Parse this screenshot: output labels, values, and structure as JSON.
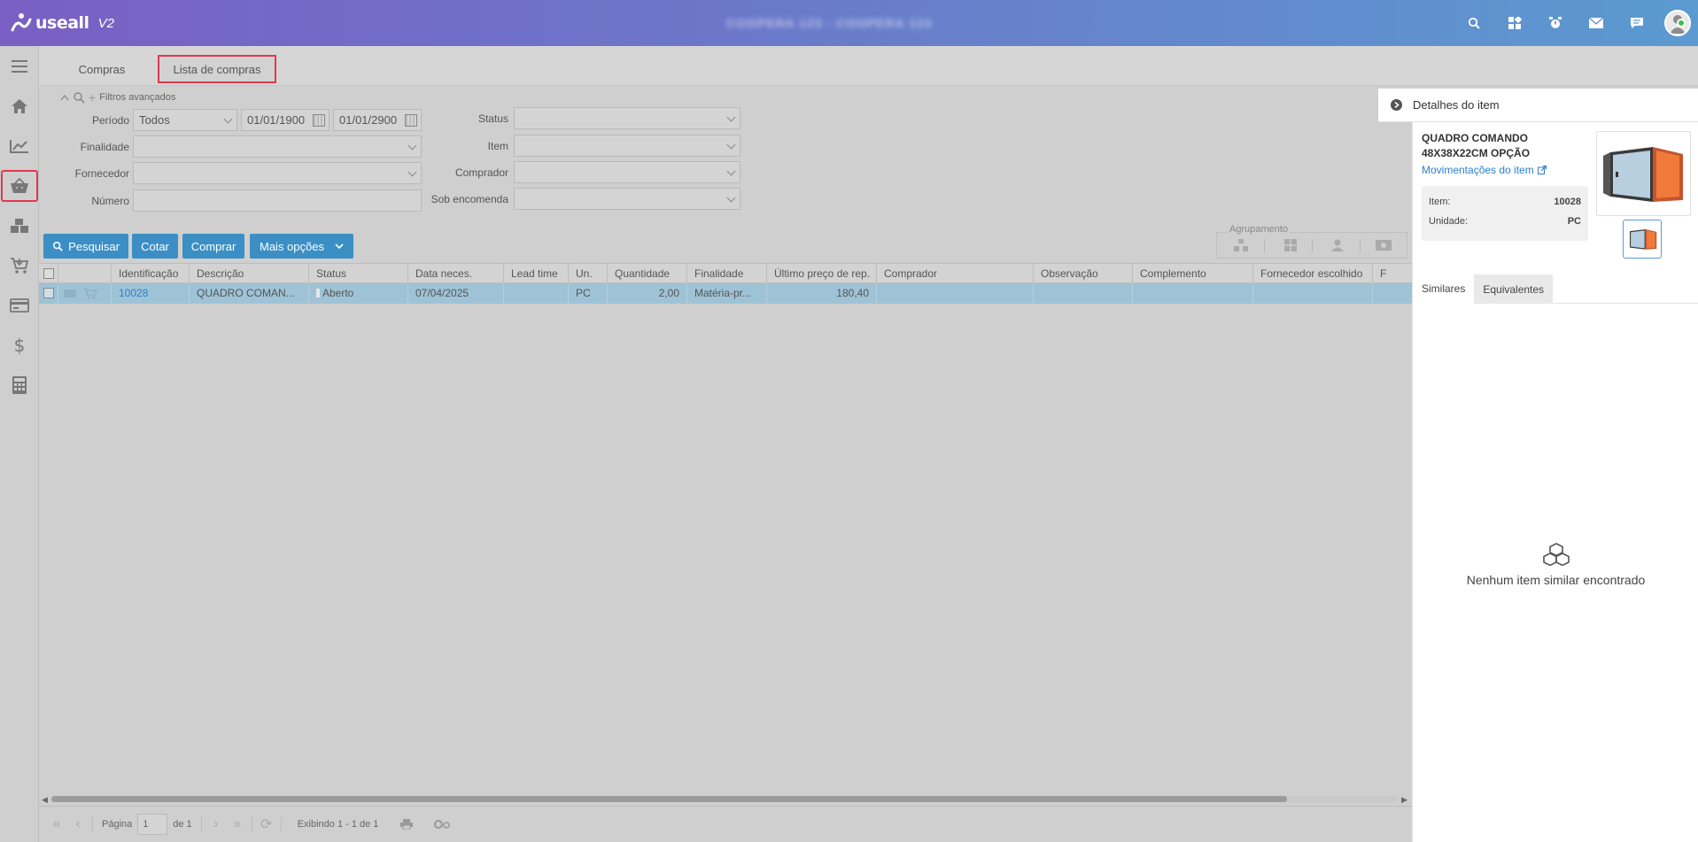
{
  "app": {
    "logo_text": "useall",
    "logo_version": "V2",
    "window_title": "COOPERA 123 - COOPERA 123"
  },
  "topbar": {
    "icons": [
      "search-icon",
      "apps-icon",
      "alarm-icon",
      "mail-icon",
      "chat-icon",
      "user-avatar"
    ]
  },
  "sidebar": {
    "items": [
      "menu-icon",
      "home-icon",
      "chart-icon",
      "basket-icon",
      "boxes-icon",
      "cart-icon",
      "card-icon",
      "dollar-icon",
      "calculator-icon"
    ],
    "active": "basket-icon"
  },
  "tabs": [
    {
      "label": "Compras"
    },
    {
      "label": "Lista de compras"
    }
  ],
  "filters": {
    "advanced_label": "Filtros avançados",
    "periodo_label": "Período",
    "periodo_value": "Todos",
    "date_from": "01/01/1900",
    "date_to": "01/01/2900",
    "finalidade_label": "Finalidade",
    "fornecedor_label": "Fornecedor",
    "numero_label": "Número",
    "status_label": "Status",
    "item_label": "Item",
    "comprador_label": "Comprador",
    "sob_encomenda_label": "Sob encomenda"
  },
  "toolbar": {
    "pesquisar": "Pesquisar",
    "cotar": "Cotar",
    "comprar": "Comprar",
    "mais_opcoes": "Mais opções",
    "agrupamento_label": "Agrupamento"
  },
  "table": {
    "columns": [
      "Identificação",
      "Descrição",
      "Status",
      "Data neces.",
      "Lead time",
      "Un.",
      "Quantidade",
      "Finalidade",
      "Último preço de rep.",
      "Comprador",
      "Observação",
      "Complemento",
      "Fornecedor escolhido",
      "F"
    ],
    "rows": [
      {
        "id": "10028",
        "descricao": "QUADRO COMAN...",
        "status": "Aberto",
        "data": "07/04/2025",
        "lead": "",
        "un": "PC",
        "quantidade": "2,00",
        "finalidade": "Matéria-pr...",
        "preco": "180,40",
        "comprador": "",
        "observacao": "",
        "complemento": "",
        "fornecedor": ""
      }
    ]
  },
  "pager": {
    "page_label": "Página",
    "page_value": "1",
    "of_label": "de 1",
    "display": "Exibindo 1 - 1 de 1"
  },
  "details": {
    "header": "Detalhes do item",
    "item_name": "QUADRO COMANDO 48X38X22CM OPÇÃO",
    "movements_link": "Movimentações do item",
    "item_label": "Item:",
    "item_value": "10028",
    "unit_label": "Unidade:",
    "unit_value": "PC",
    "tab_similares": "Similares",
    "tab_equivalentes": "Equivalentes",
    "empty_message": "Nenhum item similar encontrado"
  }
}
